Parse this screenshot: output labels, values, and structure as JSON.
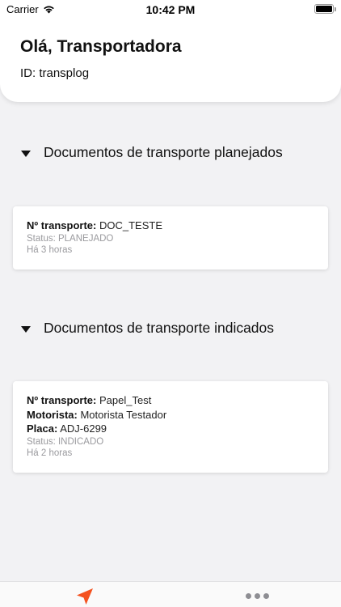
{
  "status_bar": {
    "carrier": "Carrier",
    "time": "10:42 PM"
  },
  "header": {
    "greeting": "Olá, Transportadora",
    "user_id": "ID: transplog"
  },
  "sections": {
    "planned": {
      "title": "Documentos de transporte planejados",
      "card": {
        "transport_label": "Nº transporte:",
        "transport_value": "DOC_TESTE",
        "status": "Status: PLANEJADO",
        "time_ago": "Há 3 horas"
      }
    },
    "indicated": {
      "title": "Documentos de transporte indicados",
      "card": {
        "transport_label": "Nº transporte:",
        "transport_value": "Papel_Test",
        "driver_label": "Motorista:",
        "driver_value": "Motorista Testador",
        "plate_label": "Placa:",
        "plate_value": "ADJ-6299",
        "status": "Status: INDICADO",
        "time_ago": "Há 2 horas"
      }
    }
  },
  "tab_bar": {
    "items": [
      {
        "icon": "navigation-arrow-icon",
        "active": true
      },
      {
        "icon": "more-dots-icon",
        "active": false
      }
    ],
    "accent_color": "#f4511e"
  }
}
